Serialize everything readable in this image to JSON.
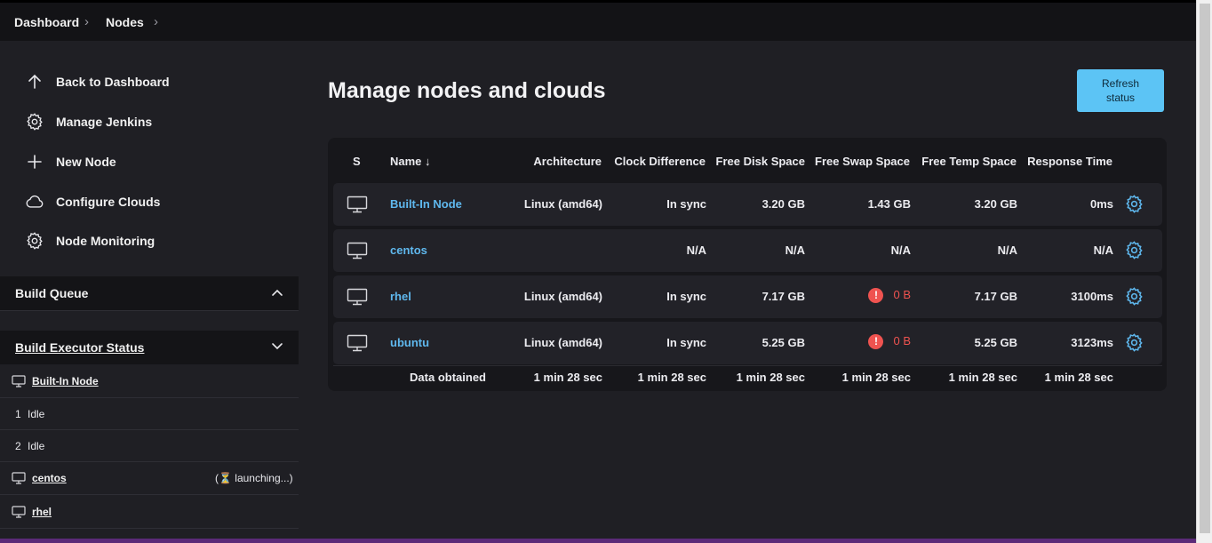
{
  "breadcrumbs": [
    "Dashboard",
    "Nodes"
  ],
  "sidebar": {
    "links": [
      {
        "label": "Back to Dashboard",
        "icon": "arrow-up-icon"
      },
      {
        "label": "Manage Jenkins",
        "icon": "gear-icon"
      },
      {
        "label": "New Node",
        "icon": "plus-icon"
      },
      {
        "label": "Configure Clouds",
        "icon": "cloud-icon"
      },
      {
        "label": "Node Monitoring",
        "icon": "gear-icon"
      }
    ],
    "build_queue": {
      "title": "Build Queue",
      "expanded": true
    },
    "build_executor_status": {
      "title": "Build Executor Status",
      "expanded": false,
      "rows": [
        {
          "type": "node",
          "name": "Built-In Node"
        },
        {
          "type": "executor",
          "number": "1",
          "status": "Idle"
        },
        {
          "type": "executor",
          "number": "2",
          "status": "Idle"
        },
        {
          "type": "node",
          "name": "centos",
          "status": "(⏳ launching...)"
        },
        {
          "type": "node",
          "name": "rhel"
        }
      ]
    }
  },
  "main": {
    "title": "Manage nodes and clouds",
    "refresh_label_line1": "Refresh",
    "refresh_label_line2": "status",
    "table": {
      "headers": {
        "s": "S",
        "name": "Name",
        "sort_indicator": "↓",
        "architecture": "Architecture",
        "clock": "Clock Difference",
        "disk": "Free Disk Space",
        "swap": "Free Swap Space",
        "temp": "Free Temp Space",
        "response": "Response Time"
      },
      "rows": [
        {
          "name": "Built-In Node",
          "architecture": "Linux (amd64)",
          "clock": "In sync",
          "disk": "3.20 GB",
          "swap": "1.43 GB",
          "swap_warning": false,
          "temp": "3.20 GB",
          "response": "0ms"
        },
        {
          "name": "centos",
          "architecture": "",
          "clock": "N/A",
          "disk": "N/A",
          "swap": "N/A",
          "swap_warning": false,
          "temp": "N/A",
          "response": "N/A"
        },
        {
          "name": "rhel",
          "architecture": "Linux (amd64)",
          "clock": "In sync",
          "disk": "7.17 GB",
          "swap": "0 B",
          "swap_warning": true,
          "temp": "7.17 GB",
          "response": "3100ms"
        },
        {
          "name": "ubuntu",
          "architecture": "Linux (amd64)",
          "clock": "In sync",
          "disk": "5.25 GB",
          "swap": "0 B",
          "swap_warning": true,
          "temp": "5.25 GB",
          "response": "3123ms"
        }
      ],
      "footer": {
        "label": "Data obtained",
        "architecture": "1 min 28 sec",
        "clock": "1 min 28 sec",
        "disk": "1 min 28 sec",
        "swap": "1 min 28 sec",
        "temp": "1 min 28 sec",
        "response": "1 min 28 sec"
      }
    }
  },
  "colors": {
    "accent": "#5cc4f5",
    "link": "#5fb8ee",
    "warning": "#ef5350",
    "background": "#1f1f24"
  }
}
